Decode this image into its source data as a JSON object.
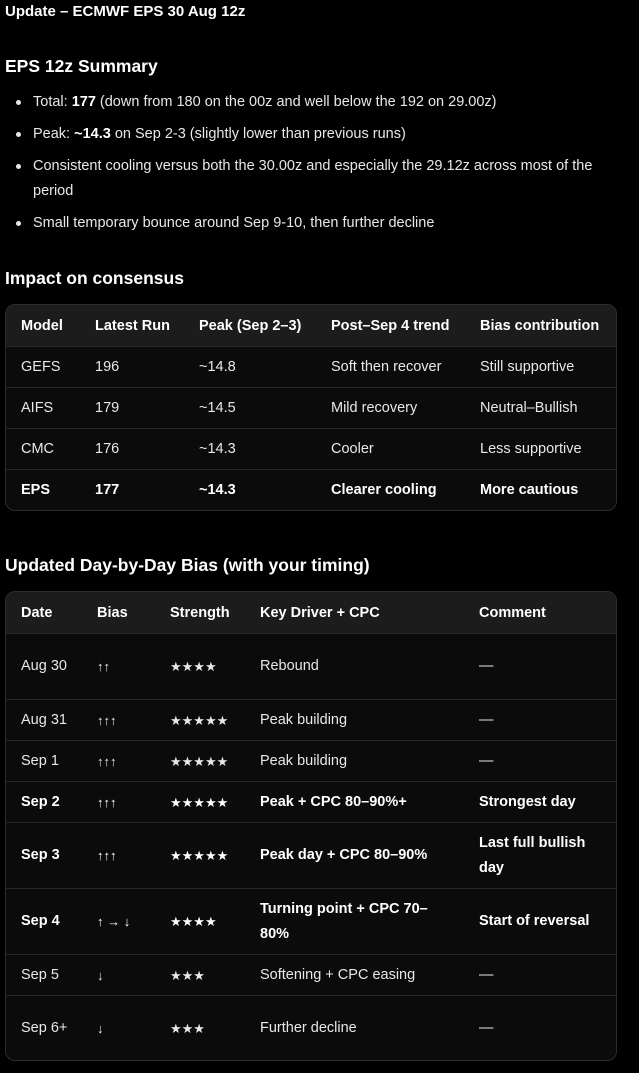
{
  "header": {
    "title": "Update – ECMWF EPS 30 Aug 12z"
  },
  "summary": {
    "title": "EPS 12z Summary",
    "items": [
      {
        "lead": "Total: ",
        "strong": "177",
        "rest": " (down from 180 on the 00z and well below the 192 on 29.00z)"
      },
      {
        "lead": "Peak: ",
        "strong": "~14.3",
        "rest": " on Sep 2-3 (slightly lower than previous runs)"
      },
      {
        "lead": "",
        "strong": "",
        "rest": "Consistent cooling versus both the 30.00z and especially the 29.12z across most of the period"
      },
      {
        "lead": "",
        "strong": "",
        "rest": "Small temporary bounce around Sep 9-10, then further decline"
      }
    ]
  },
  "impact": {
    "title": "Impact on consensus",
    "columns": [
      "Model",
      "Latest Run",
      "Peak (Sep 2–3)",
      "Post–Sep 4 trend",
      "Bias contribution"
    ],
    "rows": [
      {
        "model": "GEFS",
        "latest": "196",
        "peak": "~14.8",
        "trend": "Soft then recover",
        "bias": "Still supportive",
        "bold": false
      },
      {
        "model": "AIFS",
        "latest": "179",
        "peak": "~14.5",
        "trend": "Mild recovery",
        "bias": "Neutral–Bullish",
        "bold": false
      },
      {
        "model": "CMC",
        "latest": "176",
        "peak": "~14.3",
        "trend": "Cooler",
        "bias": "Less supportive",
        "bold": false
      },
      {
        "model": "EPS",
        "latest": "177",
        "peak": "~14.3",
        "trend": "Clearer cooling",
        "bias": "More cautious",
        "bold": true
      }
    ]
  },
  "bias": {
    "title": "Updated Day-by-Day Bias (with your timing)",
    "columns": [
      "Date",
      "Bias",
      "Strength",
      "Key Driver + CPC",
      "Comment"
    ],
    "rows": [
      {
        "date": "Aug 30",
        "bias": "↑↑",
        "strength": "★★★★",
        "driver": "Rebound",
        "comment": "—",
        "bold": false
      },
      {
        "date": "Aug 31",
        "bias": "↑↑↑",
        "strength": "★★★★★",
        "driver": "Peak building",
        "comment": "—",
        "bold": false
      },
      {
        "date": "Sep 1",
        "bias": "↑↑↑",
        "strength": "★★★★★",
        "driver": "Peak building",
        "comment": "—",
        "bold": false
      },
      {
        "date": "Sep 2",
        "bias": "↑↑↑",
        "strength": "★★★★★",
        "driver": "Peak + CPC 80–90%+",
        "comment": "Strongest day",
        "bold": true
      },
      {
        "date": "Sep 3",
        "bias": "↑↑↑",
        "strength": "★★★★★",
        "driver": "Peak day + CPC 80–90%",
        "comment": "Last full bullish day",
        "bold": true
      },
      {
        "date": "Sep 4",
        "bias": "↑ → ↓",
        "strength": "★★★★",
        "driver": "Turning point + CPC 70–80%",
        "comment": "Start of reversal",
        "bold": true
      },
      {
        "date": "Sep 5",
        "bias": "↓",
        "strength": "★★★",
        "driver": "Softening + CPC easing",
        "comment": "—",
        "bold": false
      },
      {
        "date": "Sep 6+",
        "bias": "↓",
        "strength": "★★★",
        "driver": "Further decline",
        "comment": "—",
        "bold": false
      }
    ]
  }
}
